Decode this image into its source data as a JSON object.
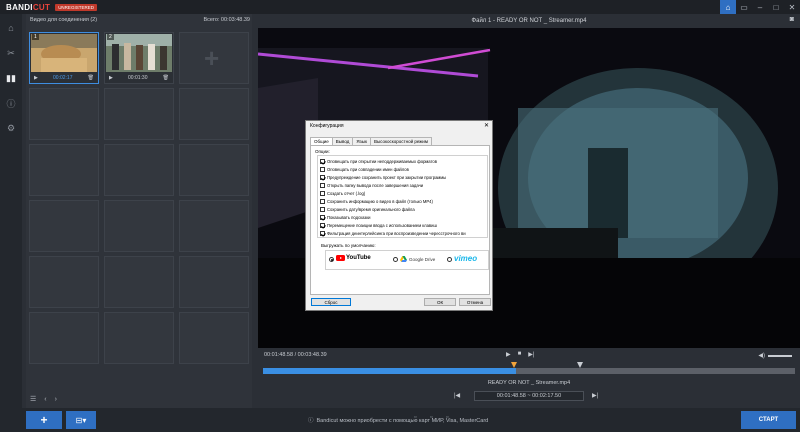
{
  "titlebar": {
    "logo_a": "BANDI",
    "logo_b": "CUT",
    "unregistered": "UNREGISTERED",
    "buttons": [
      "home-icon",
      "folder-icon",
      "minimize-icon",
      "maximize-icon",
      "close-icon"
    ]
  },
  "leftbar": {
    "items": [
      "home-icon",
      "cut-icon",
      "join-icon",
      "info-icon",
      "gear-icon"
    ]
  },
  "panel": {
    "heading": "Видео для соединения (2)",
    "total": "Всего: 00:03:48.39",
    "clips": [
      {
        "num": "1",
        "time": "00:02:17"
      },
      {
        "num": "2",
        "time": "00:01:30"
      }
    ]
  },
  "preview": {
    "title": "Файл 1 - READY OR NOT _ Streamer.mp4",
    "time": "00:01:48.58 / 00:03:48.39",
    "progress": 0.476,
    "filename": "READY OR NOT _ Streamer.mp4",
    "range": "00:01:48.58 ~ 00:02:17.50"
  },
  "bottom": {
    "add_label": "+",
    "info_text": "Bandicut можно приобрести с помощью карт МИР, Visa, MasterCard",
    "start_label": "СТАРТ"
  },
  "dialog": {
    "title": "Конфигурация",
    "tabs": [
      "Общие",
      "Вывод",
      "Язык",
      "Высокоскоростной режим"
    ],
    "options_label": "Опции:",
    "options": [
      {
        "label": "Оповещать при открытии неподдерживаемых форматов",
        "checked": true
      },
      {
        "label": "Оповещать при совпадении имен файлов",
        "checked": false
      },
      {
        "label": "Предупреждение сохранить проект при закрытии программы",
        "checked": true
      },
      {
        "label": "Открыть папку вывода после завершения задачи",
        "checked": false
      },
      {
        "label": "Создать отчет (.log)",
        "checked": false
      },
      {
        "label": "Сохранить информацию о видео в файл (только MP4)",
        "checked": false
      },
      {
        "label": "Сохранить дату/время оригинального файла",
        "checked": false
      },
      {
        "label": "Показывать подсказки",
        "checked": true
      },
      {
        "label": "Перемещение позиции ввода с использованием клавиш",
        "checked": true
      },
      {
        "label": "Фильтрация деинтерлейсинга при воспроизведении чересстрочного ви",
        "checked": true
      }
    ],
    "upload_label": "Выгружать по умолчанию:",
    "upload_services": [
      {
        "name": "YouTube",
        "selected": true
      },
      {
        "name": "Google Drive",
        "selected": false
      },
      {
        "name": "vimeo",
        "selected": false
      }
    ],
    "reset_label": "Сброс",
    "ok_label": "ОК",
    "cancel_label": "Отмена"
  }
}
